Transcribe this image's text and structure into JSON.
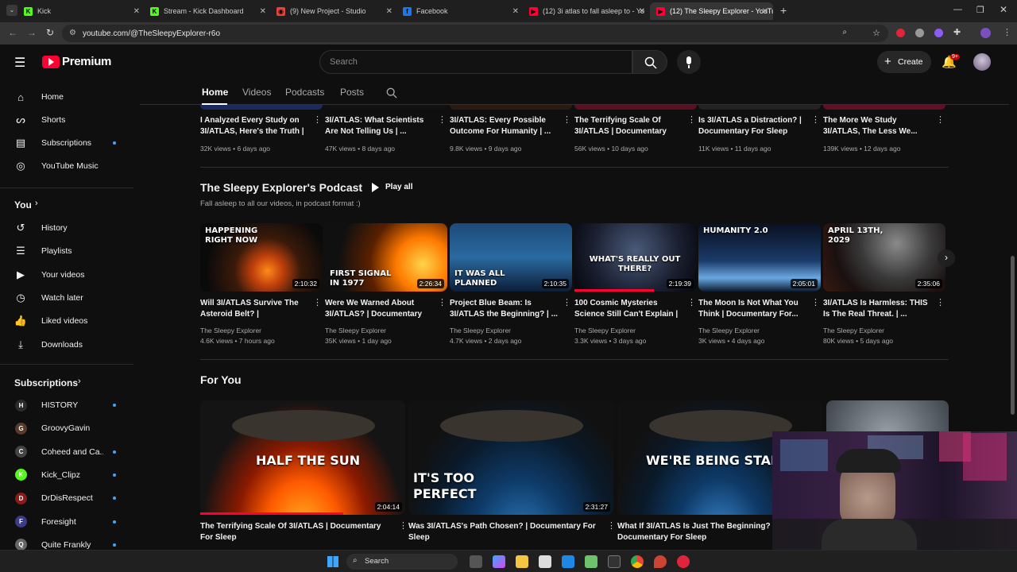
{
  "browser": {
    "tabs": [
      {
        "title": "Kick",
        "fav_color": "#53fc18",
        "fav_glyph": "K"
      },
      {
        "title": "Stream - Kick Dashboard",
        "fav_color": "#53fc18",
        "fav_glyph": "K"
      },
      {
        "title": "(9) New Project - Studio",
        "fav_color": "#e8433a",
        "fav_glyph": "◉"
      },
      {
        "title": "Facebook",
        "fav_color": "#1877f2",
        "fav_glyph": "f"
      },
      {
        "title": "(12) 3i atlas to fall asleep to - Yo",
        "fav_color": "#ff0033",
        "fav_glyph": "▶"
      },
      {
        "title": "(12) The Sleepy Explorer - YouTu",
        "fav_color": "#ff0033",
        "fav_glyph": "▶"
      }
    ],
    "url": "youtube.com/@TheSleepyExplorer-r6o"
  },
  "header": {
    "logo_text": "Premium",
    "search_placeholder": "Search",
    "create_label": "Create",
    "notif_badge": "9+"
  },
  "sidebar": {
    "main": [
      {
        "label": "Home",
        "icon": "home-icon",
        "glyph": "⌂"
      },
      {
        "label": "Shorts",
        "icon": "shorts-icon",
        "glyph": "ᔕ"
      },
      {
        "label": "Subscriptions",
        "icon": "subscriptions-icon",
        "glyph": "▤",
        "dot": true
      },
      {
        "label": "YouTube Music",
        "icon": "music-icon",
        "glyph": "◎"
      }
    ],
    "you_label": "You",
    "you": [
      {
        "label": "History",
        "icon": "history-icon",
        "glyph": "↺"
      },
      {
        "label": "Playlists",
        "icon": "playlists-icon",
        "glyph": "☰"
      },
      {
        "label": "Your videos",
        "icon": "your-videos-icon",
        "glyph": "▶"
      },
      {
        "label": "Watch later",
        "icon": "watch-later-icon",
        "glyph": "◷"
      },
      {
        "label": "Liked videos",
        "icon": "like-icon",
        "glyph": "👍"
      },
      {
        "label": "Downloads",
        "icon": "download-icon",
        "glyph": "⤓"
      }
    ],
    "subscriptions_label": "Subscriptions",
    "subscriptions": [
      {
        "label": "HISTORY",
        "color": "#2b2b2b",
        "glyph": "H",
        "dot": true
      },
      {
        "label": "GroovyGavin",
        "color": "#5a3a2a",
        "glyph": "G",
        "dot": false
      },
      {
        "label": "Coheed and Ca...",
        "color": "#444",
        "glyph": "C",
        "dot": true
      },
      {
        "label": "Kick_Clipz",
        "color": "#53fc18",
        "glyph": "K",
        "dot": true
      },
      {
        "label": "DrDisRespect",
        "color": "#8b1a1a",
        "glyph": "D",
        "dot": true
      },
      {
        "label": "Foresight",
        "color": "#3b3b8b",
        "glyph": "F",
        "dot": true
      },
      {
        "label": "Quite Frankly",
        "color": "#666",
        "glyph": "Q",
        "dot": true
      }
    ]
  },
  "channel_tabs": [
    "Home",
    "Videos",
    "Podcasts",
    "Posts"
  ],
  "top_row": [
    {
      "title": "I Analyzed Every Study on 3I/ATLAS, Here's the Truth | ...",
      "meta": "32K views • 6 days ago"
    },
    {
      "title": "3I/ATLAS: What Scientists Are Not Telling Us | ...",
      "meta": "47K views • 8 days ago"
    },
    {
      "title": "3I/ATLAS: Every Possible Outcome For Humanity | ...",
      "meta": "9.8K views • 9 days ago"
    },
    {
      "title": "The Terrifying Scale Of 3I/ATLAS | Documentary Fo...",
      "meta": "56K views • 10 days ago"
    },
    {
      "title": "Is 3I/ATLAS a Distraction? | Documentary For Sleep",
      "meta": "11K views • 11 days ago"
    },
    {
      "title": "The More We Study 3I/ATLAS, The Less We...",
      "meta": "139K views • 12 days ago"
    }
  ],
  "podcast": {
    "title": "The Sleepy Explorer's Podcast",
    "play_all": "Play all",
    "subtitle": "Fall asleep to all our videos, in podcast format :)",
    "videos": [
      {
        "title": "Will 3I/ATLAS Survive The Asteroid Belt? | Documentar...",
        "channel": "The Sleepy Explorer",
        "meta": "4.6K views • 7 hours ago",
        "duration": "2:10:32",
        "overlay": "HAPPENING RIGHT NOW"
      },
      {
        "title": "Were We Warned About 3I/ATLAS? | Documentary F...",
        "channel": "The Sleepy Explorer",
        "meta": "35K views • 1 day ago",
        "duration": "2:26:34",
        "overlay": "FIRST SIGNAL IN 1977"
      },
      {
        "title": "Project Blue Beam: Is 3I/ATLAS the Beginning? | ...",
        "channel": "The Sleepy Explorer",
        "meta": "4.7K views • 2 days ago",
        "duration": "2:10:35",
        "overlay": "IT WAS ALL PLANNED"
      },
      {
        "title": "100 Cosmic Mysteries Science Still Can't Explain | ...",
        "channel": "The Sleepy Explorer",
        "meta": "3.3K views • 3 days ago",
        "duration": "2:19:39",
        "overlay": "WHAT'S REALLY OUT THERE?"
      },
      {
        "title": "The Moon Is Not What You Think | Documentary For...",
        "channel": "The Sleepy Explorer",
        "meta": "3K views • 4 days ago",
        "duration": "2:05:01",
        "overlay": "HUMANITY 2.0"
      },
      {
        "title": "3I/ATLAS Is Harmless: THIS Is The Real Threat. | ...",
        "channel": "The Sleepy Explorer",
        "meta": "80K views • 5 days ago",
        "duration": "2:35:06",
        "overlay": "APRIL 13TH, 2029"
      }
    ]
  },
  "for_you": {
    "title": "For You",
    "videos": [
      {
        "title": "The Terrifying Scale Of 3I/ATLAS | Documentary For Sleep",
        "duration": "2:04:14",
        "overlay": "HALF THE SUN"
      },
      {
        "title": "Was 3I/ATLAS's Path Chosen? | Documentary For Sleep",
        "duration": "2:31:27",
        "overlay": "IT'S TOO PERFECT"
      },
      {
        "title": "What If 3I/ATLAS Is Just The Beginning? | Documentary For Sleep",
        "duration": "",
        "overlay": "WE'RE BEING STALKE"
      }
    ]
  },
  "taskbar": {
    "search_label": "Search"
  }
}
